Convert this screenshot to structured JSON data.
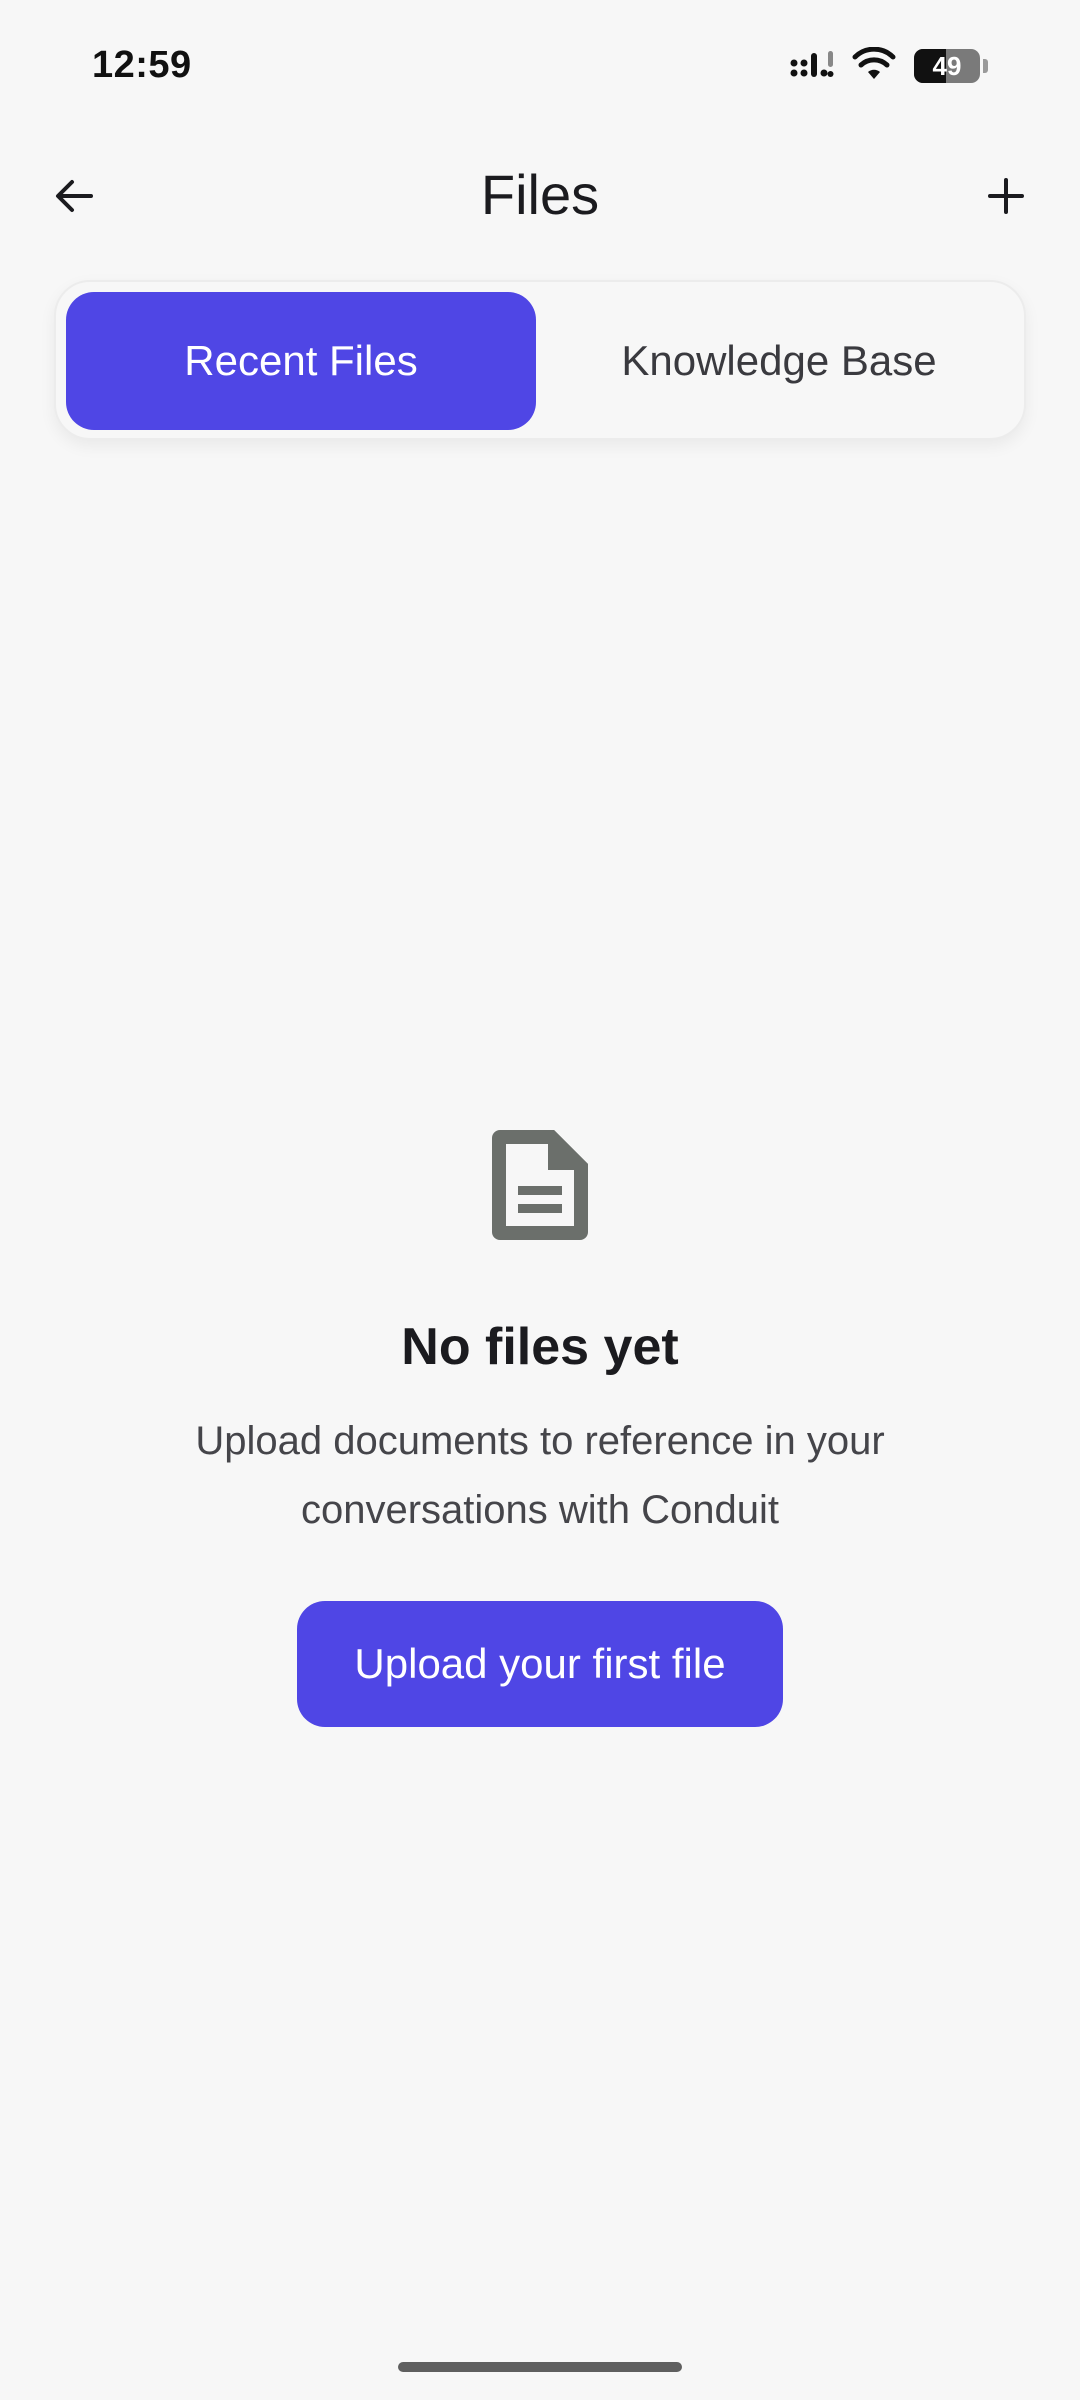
{
  "status_bar": {
    "time": "12:59",
    "battery": "49",
    "battery_level": 0.49,
    "icons": [
      "signal-icon",
      "wifi-icon",
      "battery-icon"
    ]
  },
  "app_bar": {
    "title": "Files",
    "back_icon": "arrow-left-icon",
    "add_icon": "plus-icon"
  },
  "tabs": [
    {
      "label": "Recent Files",
      "active": true
    },
    {
      "label": "Knowledge Base",
      "active": false
    }
  ],
  "empty_state": {
    "icon": "document-icon",
    "title": "No files yet",
    "subtitle": "Upload documents to reference in your conversations with Conduit",
    "button_label": "Upload your first file"
  },
  "colors": {
    "accent": "#4f46e5",
    "background": "#f7f7f7",
    "icon_gray": "#6b6f6b"
  }
}
